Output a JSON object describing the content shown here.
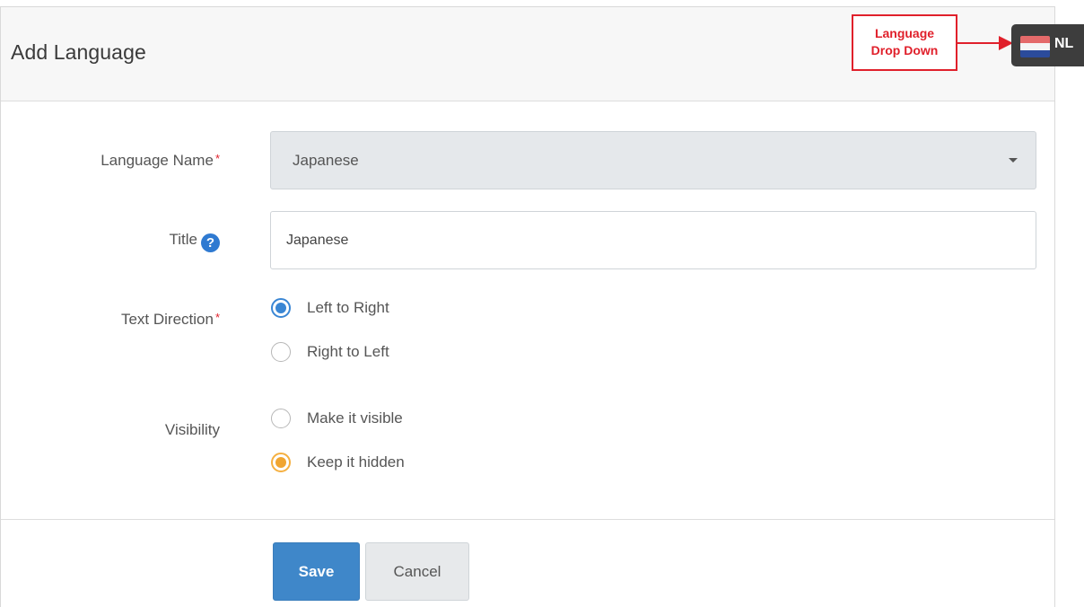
{
  "header": {
    "title": "Add Language"
  },
  "annotation": {
    "line1": "Language",
    "line2": "Drop Down",
    "color": "#e0202b"
  },
  "language_dropdown": {
    "code": "NL",
    "flag_icon": "netherlands-flag-icon"
  },
  "form": {
    "language_name": {
      "label": "Language Name",
      "required_mark": "*",
      "value": "Japanese"
    },
    "title": {
      "label": "Title",
      "help_icon": "?",
      "value": "Japanese"
    },
    "text_direction": {
      "label": "Text Direction",
      "required_mark": "*",
      "options": [
        {
          "label": "Left to Right",
          "selected": true
        },
        {
          "label": "Right to Left",
          "selected": false
        }
      ]
    },
    "visibility": {
      "label": "Visibility",
      "options": [
        {
          "label": "Make it visible",
          "selected": false
        },
        {
          "label": "Keep it hidden",
          "selected": true
        }
      ]
    }
  },
  "actions": {
    "save_label": "Save",
    "cancel_label": "Cancel"
  },
  "colors": {
    "primary": "#3f87c9",
    "warning": "#f0a531",
    "required": "#e0202b"
  }
}
